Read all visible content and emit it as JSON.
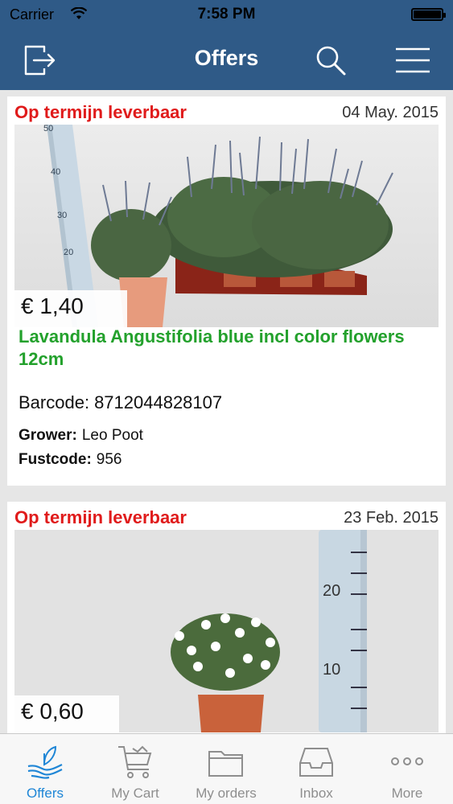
{
  "status_bar": {
    "carrier": "Carrier",
    "time": "7:58 PM"
  },
  "nav": {
    "title": "Offers"
  },
  "offers": [
    {
      "status": "Op termijn leverbaar",
      "date": "04 May. 2015",
      "price": "€ 1,40",
      "name": "Lavandula Angustifolia blue incl color flowers 12cm",
      "barcode_label": "Barcode:",
      "barcode": "8712044828107",
      "grower_label": "Grower:",
      "grower": "Leo Poot",
      "fustcode_label": "Fustcode:",
      "fustcode": "956",
      "photo_ruler_ticks": [
        "50",
        "40",
        "30",
        "20"
      ]
    },
    {
      "status": "Op termijn leverbaar",
      "date": "23 Feb. 2015",
      "price": "€ 0,60",
      "photo_ruler_ticks": [
        "20",
        "10"
      ]
    }
  ],
  "tabs": [
    {
      "label": "Offers",
      "icon": "plant-hand-icon",
      "active": true
    },
    {
      "label": "My Cart",
      "icon": "cart-icon",
      "active": false
    },
    {
      "label": "My orders",
      "icon": "folder-icon",
      "active": false
    },
    {
      "label": "Inbox",
      "icon": "inbox-tray-icon",
      "active": false
    },
    {
      "label": "More",
      "icon": "more-dots-icon",
      "active": false
    }
  ],
  "colors": {
    "nav_background": "#2f5a87",
    "status_red": "#e01b1b",
    "name_green": "#23a12c",
    "tab_active": "#1f86d6",
    "tab_inactive": "#8e8e8e"
  }
}
